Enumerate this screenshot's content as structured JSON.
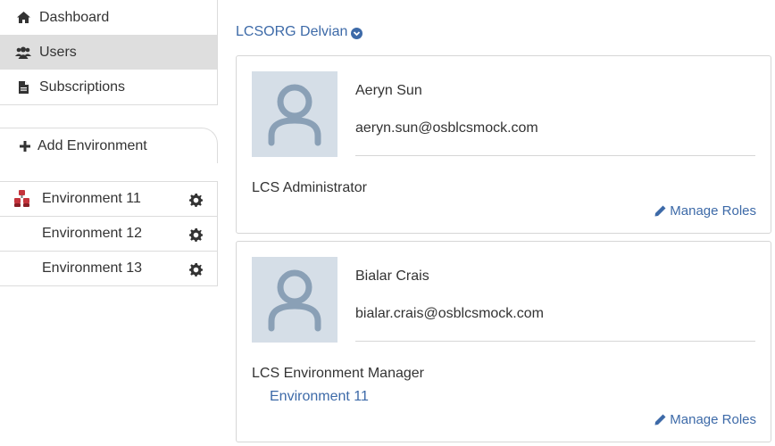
{
  "nav": {
    "items": [
      {
        "label": "Dashboard",
        "icon": "home-icon",
        "active": false
      },
      {
        "label": "Users",
        "icon": "users-icon",
        "active": true
      },
      {
        "label": "Subscriptions",
        "icon": "document-icon",
        "active": false
      }
    ]
  },
  "add_environment": {
    "label": "Add Environment",
    "icon": "plus-icon"
  },
  "environments": [
    {
      "label": "Environment 11",
      "has_icon": true
    },
    {
      "label": "Environment 12",
      "has_icon": false
    },
    {
      "label": "Environment 13",
      "has_icon": false
    }
  ],
  "org": {
    "label": "LCSORG Delvian"
  },
  "users": [
    {
      "name": "Aeryn Sun",
      "email": "aeryn.sun@osblcsmock.com",
      "role": "LCS Administrator",
      "environment": "",
      "manage_label": "Manage Roles"
    },
    {
      "name": "Bialar Crais",
      "email": "bialar.crais@osblcsmock.com",
      "role": "LCS Environment Manager",
      "environment": "Environment 11",
      "manage_label": "Manage Roles"
    }
  ],
  "colors": {
    "link": "#3d6aa8",
    "active_nav": "#dedede",
    "avatar_bg": "#d5dee7",
    "avatar_fg": "#8aa0b6",
    "env_icon": "#c4343c"
  }
}
